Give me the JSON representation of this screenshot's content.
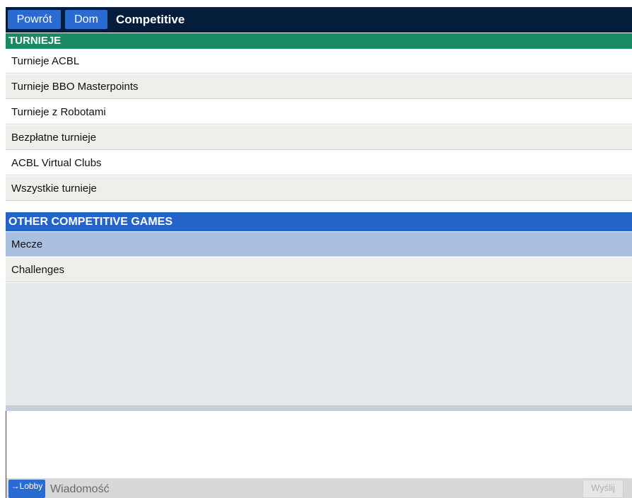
{
  "topbar": {
    "back_label": "Powrót",
    "home_label": "Dom",
    "title": "Competitive"
  },
  "tournaments": {
    "header": "TURNIEJE",
    "items": [
      {
        "label": "Turnieje ACBL"
      },
      {
        "label": "Turnieje BBO Masterpoints"
      },
      {
        "label": "Turnieje z Robotami"
      },
      {
        "label": "Bezpłatne turnieje"
      },
      {
        "label": "ACBL Virtual Clubs"
      },
      {
        "label": "Wszystkie turnieje"
      }
    ]
  },
  "other_games": {
    "header": "OTHER COMPETITIVE GAMES",
    "items": [
      {
        "label": "Mecze",
        "selected": true
      },
      {
        "label": "Challenges",
        "selected": false
      }
    ]
  },
  "chat": {
    "lobby_label": "→Lobby",
    "message_placeholder": "Wiadomość",
    "send_label": "Wyślij"
  },
  "colors": {
    "topbar": "#041d3b",
    "button": "#2a6bd2",
    "section_green": "#1a8a63",
    "section_blue": "#2264c8",
    "selected_row": "#a8bfe0"
  }
}
